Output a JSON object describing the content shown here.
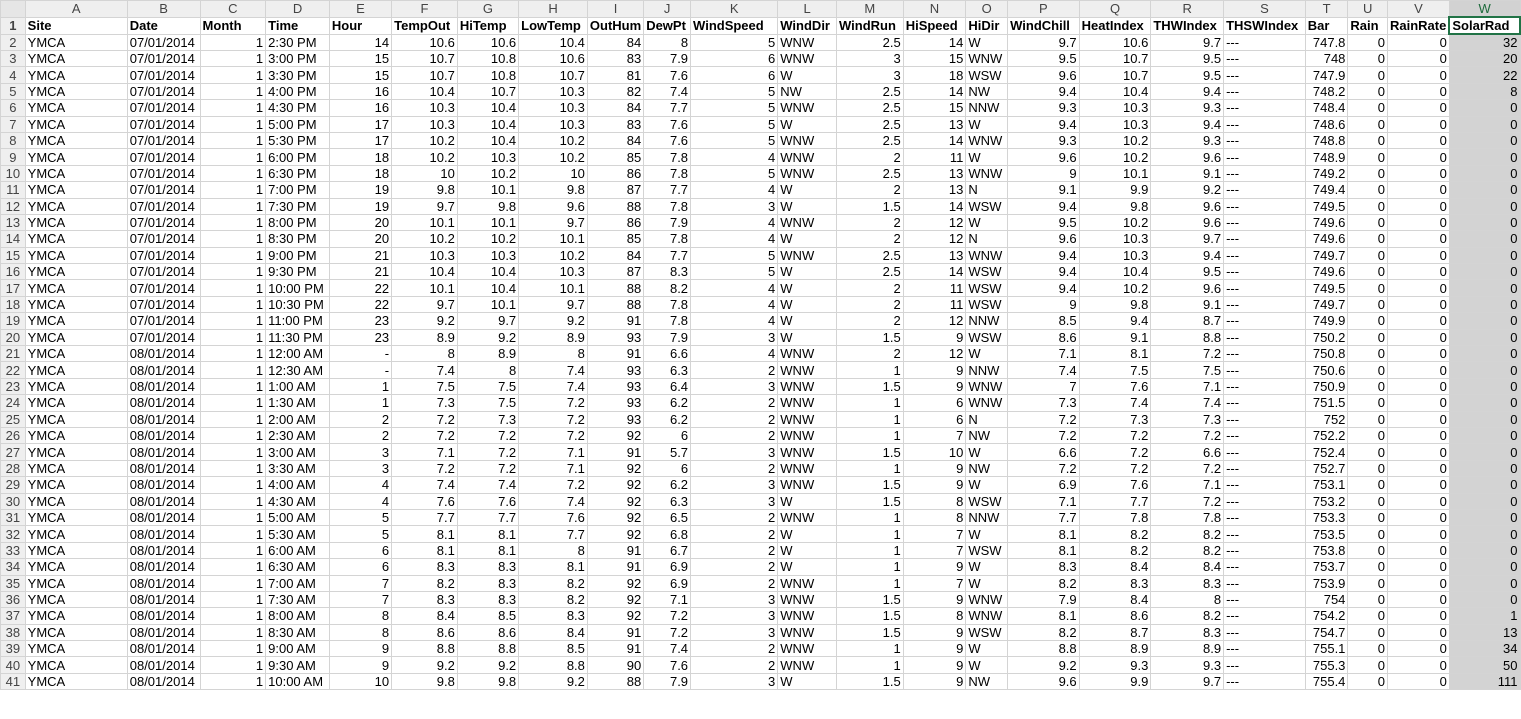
{
  "columns": [
    "A",
    "B",
    "C",
    "D",
    "E",
    "F",
    "G",
    "H",
    "I",
    "J",
    "K",
    "L",
    "M",
    "N",
    "O",
    "P",
    "Q",
    "R",
    "S",
    "T",
    "U",
    "V",
    "W"
  ],
  "headers": [
    "Site",
    "Date",
    "Month",
    "Time",
    "Hour",
    "TempOut",
    "HiTemp",
    "LowTemp",
    "OutHum",
    "DewPt",
    "WindSpeed",
    "WindDir",
    "WindRun",
    "HiSpeed",
    "HiDir",
    "WindChill",
    "HeatIndex",
    "THWIndex",
    "THSWIndex",
    "Bar",
    "Rain",
    "RainRate",
    "SolarRad"
  ],
  "rows": [
    [
      "YMCA",
      "07/01/2014",
      "1",
      "2:30 PM",
      "14",
      "10.6",
      "10.6",
      "10.4",
      "84",
      "8",
      "5",
      "WNW",
      "2.5",
      "14",
      "W",
      "9.7",
      "10.6",
      "9.7",
      "---",
      "747.8",
      "0",
      "0",
      "32"
    ],
    [
      "YMCA",
      "07/01/2014",
      "1",
      "3:00 PM",
      "15",
      "10.7",
      "10.8",
      "10.6",
      "83",
      "7.9",
      "6",
      "WNW",
      "3",
      "15",
      "WNW",
      "9.5",
      "10.7",
      "9.5",
      "---",
      "748",
      "0",
      "0",
      "20"
    ],
    [
      "YMCA",
      "07/01/2014",
      "1",
      "3:30 PM",
      "15",
      "10.7",
      "10.8",
      "10.7",
      "81",
      "7.6",
      "6",
      "W",
      "3",
      "18",
      "WSW",
      "9.6",
      "10.7",
      "9.5",
      "---",
      "747.9",
      "0",
      "0",
      "22"
    ],
    [
      "YMCA",
      "07/01/2014",
      "1",
      "4:00 PM",
      "16",
      "10.4",
      "10.7",
      "10.3",
      "82",
      "7.4",
      "5",
      "NW",
      "2.5",
      "14",
      "NW",
      "9.4",
      "10.4",
      "9.4",
      "---",
      "748.2",
      "0",
      "0",
      "8"
    ],
    [
      "YMCA",
      "07/01/2014",
      "1",
      "4:30 PM",
      "16",
      "10.3",
      "10.4",
      "10.3",
      "84",
      "7.7",
      "5",
      "WNW",
      "2.5",
      "15",
      "NNW",
      "9.3",
      "10.3",
      "9.3",
      "---",
      "748.4",
      "0",
      "0",
      "0"
    ],
    [
      "YMCA",
      "07/01/2014",
      "1",
      "5:00 PM",
      "17",
      "10.3",
      "10.4",
      "10.3",
      "83",
      "7.6",
      "5",
      "W",
      "2.5",
      "13",
      "W",
      "9.4",
      "10.3",
      "9.4",
      "---",
      "748.6",
      "0",
      "0",
      "0"
    ],
    [
      "YMCA",
      "07/01/2014",
      "1",
      "5:30 PM",
      "17",
      "10.2",
      "10.4",
      "10.2",
      "84",
      "7.6",
      "5",
      "WNW",
      "2.5",
      "14",
      "WNW",
      "9.3",
      "10.2",
      "9.3",
      "---",
      "748.8",
      "0",
      "0",
      "0"
    ],
    [
      "YMCA",
      "07/01/2014",
      "1",
      "6:00 PM",
      "18",
      "10.2",
      "10.3",
      "10.2",
      "85",
      "7.8",
      "4",
      "WNW",
      "2",
      "11",
      "W",
      "9.6",
      "10.2",
      "9.6",
      "---",
      "748.9",
      "0",
      "0",
      "0"
    ],
    [
      "YMCA",
      "07/01/2014",
      "1",
      "6:30 PM",
      "18",
      "10",
      "10.2",
      "10",
      "86",
      "7.8",
      "5",
      "WNW",
      "2.5",
      "13",
      "WNW",
      "9",
      "10.1",
      "9.1",
      "---",
      "749.2",
      "0",
      "0",
      "0"
    ],
    [
      "YMCA",
      "07/01/2014",
      "1",
      "7:00 PM",
      "19",
      "9.8",
      "10.1",
      "9.8",
      "87",
      "7.7",
      "4",
      "W",
      "2",
      "13",
      "N",
      "9.1",
      "9.9",
      "9.2",
      "---",
      "749.4",
      "0",
      "0",
      "0"
    ],
    [
      "YMCA",
      "07/01/2014",
      "1",
      "7:30 PM",
      "19",
      "9.7",
      "9.8",
      "9.6",
      "88",
      "7.8",
      "3",
      "W",
      "1.5",
      "14",
      "WSW",
      "9.4",
      "9.8",
      "9.6",
      "---",
      "749.5",
      "0",
      "0",
      "0"
    ],
    [
      "YMCA",
      "07/01/2014",
      "1",
      "8:00 PM",
      "20",
      "10.1",
      "10.1",
      "9.7",
      "86",
      "7.9",
      "4",
      "WNW",
      "2",
      "12",
      "W",
      "9.5",
      "10.2",
      "9.6",
      "---",
      "749.6",
      "0",
      "0",
      "0"
    ],
    [
      "YMCA",
      "07/01/2014",
      "1",
      "8:30 PM",
      "20",
      "10.2",
      "10.2",
      "10.1",
      "85",
      "7.8",
      "4",
      "W",
      "2",
      "12",
      "N",
      "9.6",
      "10.3",
      "9.7",
      "---",
      "749.6",
      "0",
      "0",
      "0"
    ],
    [
      "YMCA",
      "07/01/2014",
      "1",
      "9:00 PM",
      "21",
      "10.3",
      "10.3",
      "10.2",
      "84",
      "7.7",
      "5",
      "WNW",
      "2.5",
      "13",
      "WNW",
      "9.4",
      "10.3",
      "9.4",
      "---",
      "749.7",
      "0",
      "0",
      "0"
    ],
    [
      "YMCA",
      "07/01/2014",
      "1",
      "9:30 PM",
      "21",
      "10.4",
      "10.4",
      "10.3",
      "87",
      "8.3",
      "5",
      "W",
      "2.5",
      "14",
      "WSW",
      "9.4",
      "10.4",
      "9.5",
      "---",
      "749.6",
      "0",
      "0",
      "0"
    ],
    [
      "YMCA",
      "07/01/2014",
      "1",
      "10:00 PM",
      "22",
      "10.1",
      "10.4",
      "10.1",
      "88",
      "8.2",
      "4",
      "W",
      "2",
      "11",
      "WSW",
      "9.4",
      "10.2",
      "9.6",
      "---",
      "749.5",
      "0",
      "0",
      "0"
    ],
    [
      "YMCA",
      "07/01/2014",
      "1",
      "10:30 PM",
      "22",
      "9.7",
      "10.1",
      "9.7",
      "88",
      "7.8",
      "4",
      "W",
      "2",
      "11",
      "WSW",
      "9",
      "9.8",
      "9.1",
      "---",
      "749.7",
      "0",
      "0",
      "0"
    ],
    [
      "YMCA",
      "07/01/2014",
      "1",
      "11:00 PM",
      "23",
      "9.2",
      "9.7",
      "9.2",
      "91",
      "7.8",
      "4",
      "W",
      "2",
      "12",
      "NNW",
      "8.5",
      "9.4",
      "8.7",
      "---",
      "749.9",
      "0",
      "0",
      "0"
    ],
    [
      "YMCA",
      "07/01/2014",
      "1",
      "11:30 PM",
      "23",
      "8.9",
      "9.2",
      "8.9",
      "93",
      "7.9",
      "3",
      "W",
      "1.5",
      "9",
      "WSW",
      "8.6",
      "9.1",
      "8.8",
      "---",
      "750.2",
      "0",
      "0",
      "0"
    ],
    [
      "YMCA",
      "08/01/2014",
      "1",
      "12:00 AM",
      "-",
      "8",
      "8.9",
      "8",
      "91",
      "6.6",
      "4",
      "WNW",
      "2",
      "12",
      "W",
      "7.1",
      "8.1",
      "7.2",
      "---",
      "750.8",
      "0",
      "0",
      "0"
    ],
    [
      "YMCA",
      "08/01/2014",
      "1",
      "12:30 AM",
      "-",
      "7.4",
      "8",
      "7.4",
      "93",
      "6.3",
      "2",
      "WNW",
      "1",
      "9",
      "NNW",
      "7.4",
      "7.5",
      "7.5",
      "---",
      "750.6",
      "0",
      "0",
      "0"
    ],
    [
      "YMCA",
      "08/01/2014",
      "1",
      "1:00 AM",
      "1",
      "7.5",
      "7.5",
      "7.4",
      "93",
      "6.4",
      "3",
      "WNW",
      "1.5",
      "9",
      "WNW",
      "7",
      "7.6",
      "7.1",
      "---",
      "750.9",
      "0",
      "0",
      "0"
    ],
    [
      "YMCA",
      "08/01/2014",
      "1",
      "1:30 AM",
      "1",
      "7.3",
      "7.5",
      "7.2",
      "93",
      "6.2",
      "2",
      "WNW",
      "1",
      "6",
      "WNW",
      "7.3",
      "7.4",
      "7.4",
      "---",
      "751.5",
      "0",
      "0",
      "0"
    ],
    [
      "YMCA",
      "08/01/2014",
      "1",
      "2:00 AM",
      "2",
      "7.2",
      "7.3",
      "7.2",
      "93",
      "6.2",
      "2",
      "WNW",
      "1",
      "6",
      "N",
      "7.2",
      "7.3",
      "7.3",
      "---",
      "752",
      "0",
      "0",
      "0"
    ],
    [
      "YMCA",
      "08/01/2014",
      "1",
      "2:30 AM",
      "2",
      "7.2",
      "7.2",
      "7.2",
      "92",
      "6",
      "2",
      "WNW",
      "1",
      "7",
      "NW",
      "7.2",
      "7.2",
      "7.2",
      "---",
      "752.2",
      "0",
      "0",
      "0"
    ],
    [
      "YMCA",
      "08/01/2014",
      "1",
      "3:00 AM",
      "3",
      "7.1",
      "7.2",
      "7.1",
      "91",
      "5.7",
      "3",
      "WNW",
      "1.5",
      "10",
      "W",
      "6.6",
      "7.2",
      "6.6",
      "---",
      "752.4",
      "0",
      "0",
      "0"
    ],
    [
      "YMCA",
      "08/01/2014",
      "1",
      "3:30 AM",
      "3",
      "7.2",
      "7.2",
      "7.1",
      "92",
      "6",
      "2",
      "WNW",
      "1",
      "9",
      "NW",
      "7.2",
      "7.2",
      "7.2",
      "---",
      "752.7",
      "0",
      "0",
      "0"
    ],
    [
      "YMCA",
      "08/01/2014",
      "1",
      "4:00 AM",
      "4",
      "7.4",
      "7.4",
      "7.2",
      "92",
      "6.2",
      "3",
      "WNW",
      "1.5",
      "9",
      "W",
      "6.9",
      "7.6",
      "7.1",
      "---",
      "753.1",
      "0",
      "0",
      "0"
    ],
    [
      "YMCA",
      "08/01/2014",
      "1",
      "4:30 AM",
      "4",
      "7.6",
      "7.6",
      "7.4",
      "92",
      "6.3",
      "3",
      "W",
      "1.5",
      "8",
      "WSW",
      "7.1",
      "7.7",
      "7.2",
      "---",
      "753.2",
      "0",
      "0",
      "0"
    ],
    [
      "YMCA",
      "08/01/2014",
      "1",
      "5:00 AM",
      "5",
      "7.7",
      "7.7",
      "7.6",
      "92",
      "6.5",
      "2",
      "WNW",
      "1",
      "8",
      "NNW",
      "7.7",
      "7.8",
      "7.8",
      "---",
      "753.3",
      "0",
      "0",
      "0"
    ],
    [
      "YMCA",
      "08/01/2014",
      "1",
      "5:30 AM",
      "5",
      "8.1",
      "8.1",
      "7.7",
      "92",
      "6.8",
      "2",
      "W",
      "1",
      "7",
      "W",
      "8.1",
      "8.2",
      "8.2",
      "---",
      "753.5",
      "0",
      "0",
      "0"
    ],
    [
      "YMCA",
      "08/01/2014",
      "1",
      "6:00 AM",
      "6",
      "8.1",
      "8.1",
      "8",
      "91",
      "6.7",
      "2",
      "W",
      "1",
      "7",
      "WSW",
      "8.1",
      "8.2",
      "8.2",
      "---",
      "753.8",
      "0",
      "0",
      "0"
    ],
    [
      "YMCA",
      "08/01/2014",
      "1",
      "6:30 AM",
      "6",
      "8.3",
      "8.3",
      "8.1",
      "91",
      "6.9",
      "2",
      "W",
      "1",
      "9",
      "W",
      "8.3",
      "8.4",
      "8.4",
      "---",
      "753.7",
      "0",
      "0",
      "0"
    ],
    [
      "YMCA",
      "08/01/2014",
      "1",
      "7:00 AM",
      "7",
      "8.2",
      "8.3",
      "8.2",
      "92",
      "6.9",
      "2",
      "WNW",
      "1",
      "7",
      "W",
      "8.2",
      "8.3",
      "8.3",
      "---",
      "753.9",
      "0",
      "0",
      "0"
    ],
    [
      "YMCA",
      "08/01/2014",
      "1",
      "7:30 AM",
      "7",
      "8.3",
      "8.3",
      "8.2",
      "92",
      "7.1",
      "3",
      "WNW",
      "1.5",
      "9",
      "WNW",
      "7.9",
      "8.4",
      "8",
      "---",
      "754",
      "0",
      "0",
      "0"
    ],
    [
      "YMCA",
      "08/01/2014",
      "1",
      "8:00 AM",
      "8",
      "8.4",
      "8.5",
      "8.3",
      "92",
      "7.2",
      "3",
      "WNW",
      "1.5",
      "8",
      "WNW",
      "8.1",
      "8.6",
      "8.2",
      "---",
      "754.2",
      "0",
      "0",
      "1"
    ],
    [
      "YMCA",
      "08/01/2014",
      "1",
      "8:30 AM",
      "8",
      "8.6",
      "8.6",
      "8.4",
      "91",
      "7.2",
      "3",
      "WNW",
      "1.5",
      "9",
      "WSW",
      "8.2",
      "8.7",
      "8.3",
      "---",
      "754.7",
      "0",
      "0",
      "13"
    ],
    [
      "YMCA",
      "08/01/2014",
      "1",
      "9:00 AM",
      "9",
      "8.8",
      "8.8",
      "8.5",
      "91",
      "7.4",
      "2",
      "WNW",
      "1",
      "9",
      "W",
      "8.8",
      "8.9",
      "8.9",
      "---",
      "755.1",
      "0",
      "0",
      "34"
    ],
    [
      "YMCA",
      "08/01/2014",
      "1",
      "9:30 AM",
      "9",
      "9.2",
      "9.2",
      "8.8",
      "90",
      "7.6",
      "2",
      "WNW",
      "1",
      "9",
      "W",
      "9.2",
      "9.3",
      "9.3",
      "---",
      "755.3",
      "0",
      "0",
      "50"
    ],
    [
      "YMCA",
      "08/01/2014",
      "1",
      "10:00 AM",
      "10",
      "9.8",
      "9.8",
      "9.2",
      "88",
      "7.9",
      "3",
      "W",
      "1.5",
      "9",
      "NW",
      "9.6",
      "9.9",
      "9.7",
      "---",
      "755.4",
      "0",
      "0",
      "111"
    ]
  ],
  "selected_column": "W",
  "colors": {
    "selection_border": "#217346",
    "selection_fill": "#d3d3d3",
    "header_bg": "#efefef",
    "grid": "#d4d4d4"
  }
}
